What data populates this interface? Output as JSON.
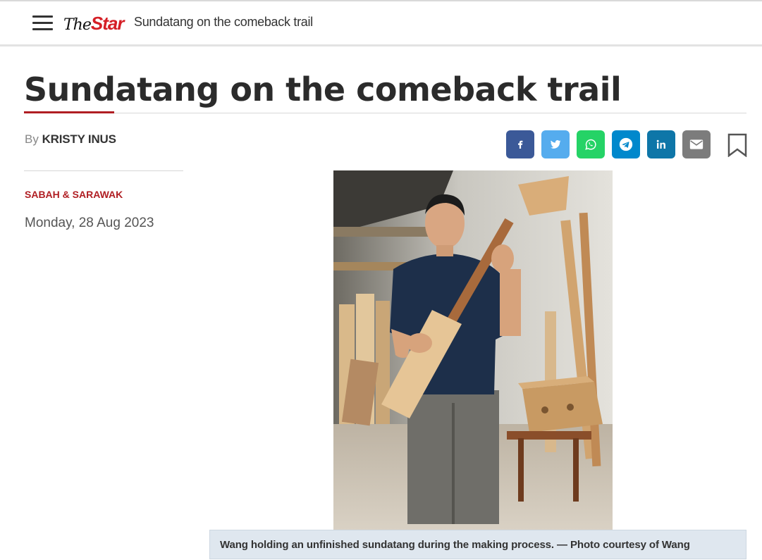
{
  "header": {
    "logo_the": "The",
    "logo_star": "Star",
    "title": "Sundatang on the comeback trail"
  },
  "article": {
    "headline": "Sundatang on the comeback trail",
    "by_label": "By",
    "author": "KRISTY INUS",
    "section": "SABAH & SARAWAK",
    "date": "Monday, 28 Aug 2023",
    "caption": "Wang holding an unfinished sundatang during the making process. — Photo courtesy of Wang"
  },
  "share": [
    {
      "name": "facebook",
      "glyph": "f",
      "color": "#3b5998"
    },
    {
      "name": "twitter",
      "glyph": "t",
      "color": "#55acee"
    },
    {
      "name": "whatsapp",
      "glyph": "w",
      "color": "#25d366"
    },
    {
      "name": "telegram",
      "glyph": "p",
      "color": "#0088cc"
    },
    {
      "name": "linkedin",
      "glyph": "in",
      "color": "#0e76a8"
    },
    {
      "name": "email",
      "glyph": "e",
      "color": "#7c7c7c"
    }
  ],
  "colors": {
    "brand_red": "#b01e23",
    "caption_bg": "#dfe7ef"
  }
}
